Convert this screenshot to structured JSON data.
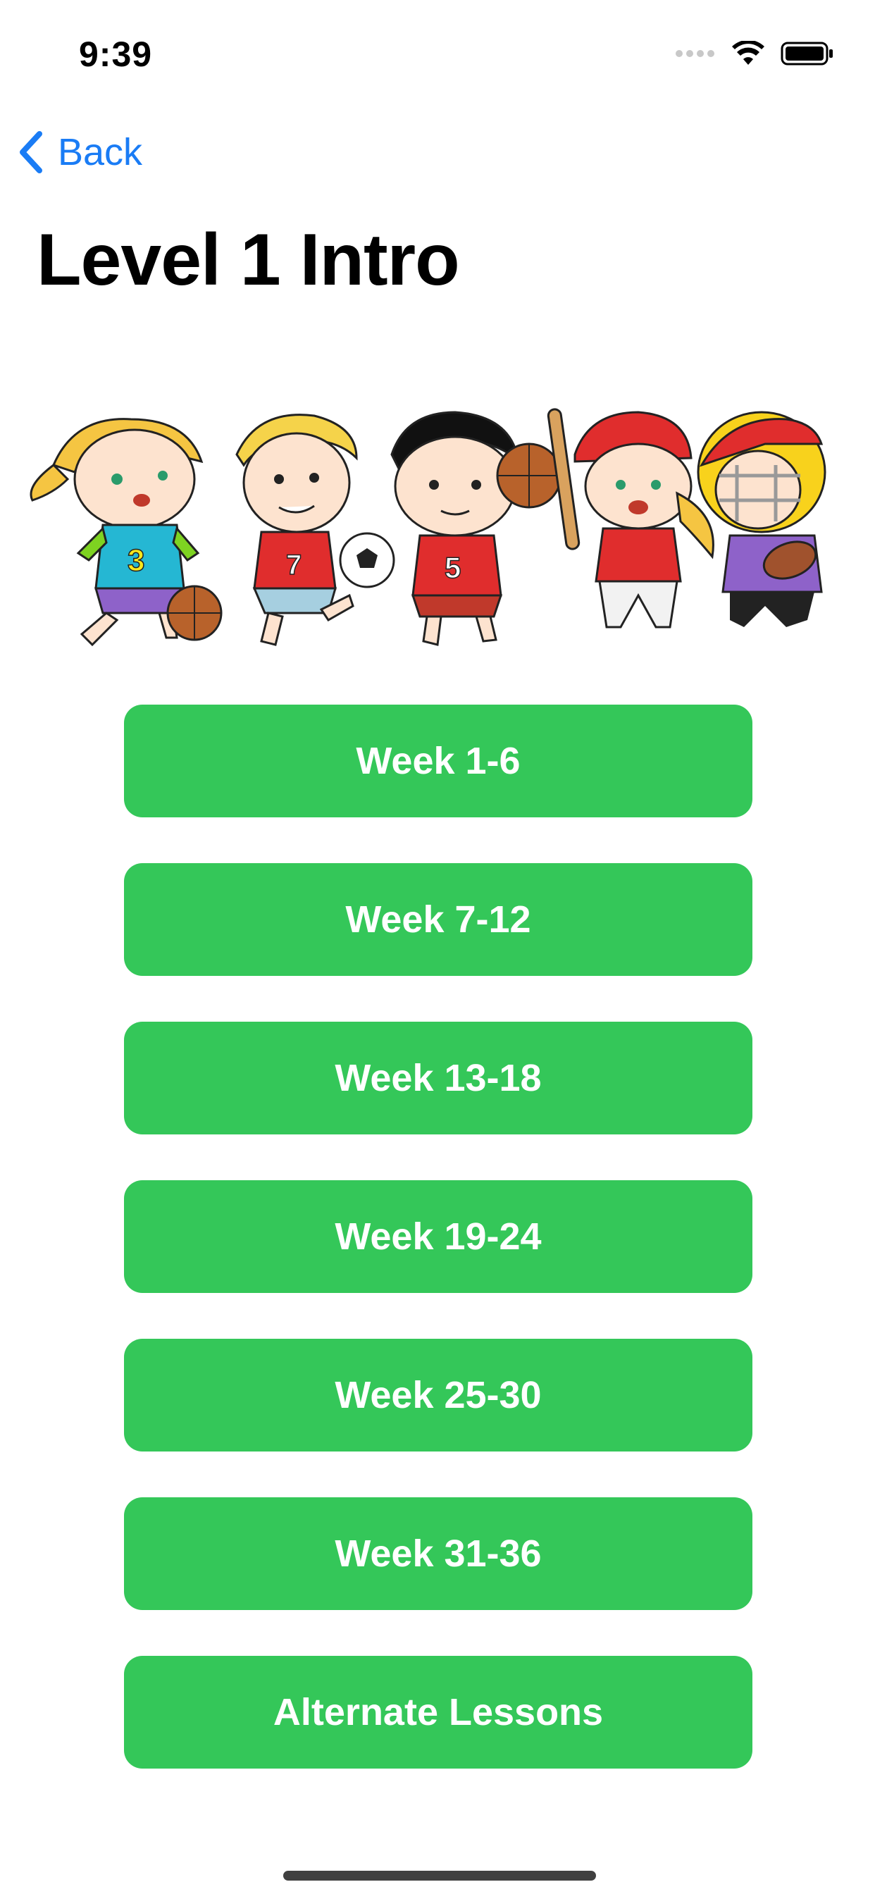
{
  "status_bar": {
    "time": "9:39",
    "icons": [
      "signal-icon",
      "wifi-icon",
      "battery-icon"
    ]
  },
  "nav": {
    "back_label": "Back",
    "back_icon": "chevron-left-icon"
  },
  "page": {
    "title": "Level 1 Intro"
  },
  "banner": {
    "image": "cartoon-kids-playing-sports-illustration",
    "jersey_numbers": [
      "3",
      "7",
      "5"
    ]
  },
  "menu": {
    "buttons": [
      {
        "label": "Week 1-6"
      },
      {
        "label": "Week 7-12"
      },
      {
        "label": "Week 13-18"
      },
      {
        "label": "Week 19-24"
      },
      {
        "label": "Week 25-30"
      },
      {
        "label": "Week 31-36"
      },
      {
        "label": "Alternate Lessons"
      }
    ]
  },
  "colors": {
    "accent_blue": "#1a7cf5",
    "button_green": "#34c759",
    "button_text": "#ffffff",
    "background": "#ffffff"
  }
}
